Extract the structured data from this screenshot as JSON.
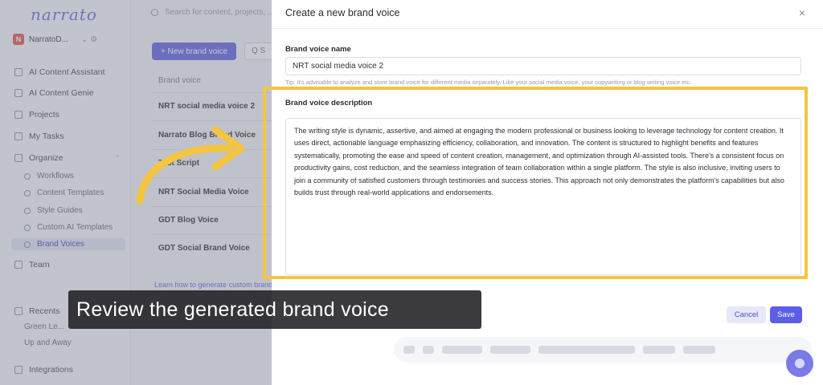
{
  "sidebar": {
    "logo": "narrato",
    "workspace_badge": "N",
    "workspace_name": "NarratoD...",
    "items": [
      {
        "label": "AI Content Assistant",
        "icon": "sparkle-icon"
      },
      {
        "label": "AI Content Genie",
        "icon": "genie-icon"
      },
      {
        "label": "Projects",
        "icon": "folder-icon"
      },
      {
        "label": "My Tasks",
        "icon": "tasks-icon"
      },
      {
        "label": "Organize",
        "icon": "organize-icon"
      }
    ],
    "sub_items": [
      "Workflows",
      "Content Templates",
      "Style Guides",
      "Custom AI Templates",
      "Brand Voices"
    ],
    "team": "Team",
    "recents": "Recents",
    "recent_items": [
      "Green Le...",
      "Up and Away"
    ],
    "integrations": "Integrations"
  },
  "main": {
    "search_placeholder": "Search for content, projects, ...",
    "new_button": "+ New brand voice",
    "search_short": "Q S",
    "column_header": "Brand voice",
    "rows": [
      "NRT social media voice 2",
      "Narrato Blog Brand Voice",
      "Test Script",
      "NRT Social Media Voice",
      "GDT Blog Voice",
      "GDT Social Brand Voice"
    ],
    "learn_link": "Learn how to generate custom brand voice"
  },
  "modal": {
    "title": "Create a new brand voice",
    "close": "×",
    "name_label": "Brand voice name",
    "name_value": "NRT social media voice 2",
    "tip": "Tip: It's advisable to analyze and store brand voice for different media separately. Like your social media voice, your copywriting or blog writing voice etc.",
    "description_label": "Brand voice description",
    "description": "The writing style is dynamic, assertive, and aimed at engaging the modern professional or business looking to leverage technology for content creation. It uses direct, actionable language emphasizing efficiency, collaboration, and innovation. The content is structured to highlight benefits and features systematically, promoting the ease and speed of content creation, management, and optimization through AI-assisted tools. There's a consistent focus on productivity gains, cost reduction, and the seamless integration of team collaboration within a single platform. The style is also inclusive, inviting users to join a community of satisfied customers through testimonies and success stories. This approach not only demonstrates the platform's capabilities but also builds trust through real-world applications and endorsements.",
    "cancel": "Cancel",
    "save": "Save"
  },
  "caption": "Review the generated brand voice",
  "colors": {
    "accent": "#5b5ee6",
    "highlight": "#f3c540",
    "caption_bg": "#202024"
  }
}
